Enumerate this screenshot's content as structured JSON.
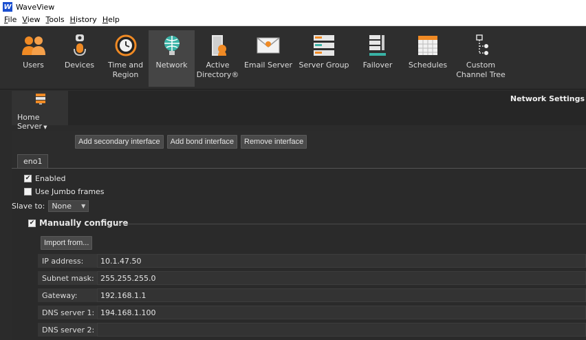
{
  "app": {
    "title": "WaveView",
    "logo_letter": "W"
  },
  "menu": [
    {
      "label": "File",
      "u": "F",
      "rest": "ile"
    },
    {
      "label": "View",
      "u": "V",
      "rest": "iew"
    },
    {
      "label": "Tools",
      "u": "T",
      "rest": "ools"
    },
    {
      "label": "History",
      "u": "H",
      "rest": "istory"
    },
    {
      "label": "Help",
      "u": "H",
      "rest": "elp"
    }
  ],
  "toolbar": {
    "users": "Users",
    "devices": "Devices",
    "time_region_1": "Time and",
    "time_region_2": "Region",
    "network": "Network",
    "ad_1": "Active",
    "ad_2": "Directory®",
    "email": "Email Server",
    "server_group": "Server Group",
    "failover": "Failover",
    "schedules": "Schedules",
    "custom_1": "Custom",
    "custom_2": "Channel Tree",
    "active_item": "Network"
  },
  "server": {
    "label": "Home Server",
    "section_title": "Network Settings"
  },
  "actions": {
    "add_secondary": "Add secondary interface",
    "add_bond": "Add bond interface",
    "remove": "Remove interface"
  },
  "tab": {
    "label": "eno1"
  },
  "options": {
    "enabled_label": "Enabled",
    "enabled_checked": true,
    "jumbo_label": "Use Jumbo frames",
    "jumbo_checked": false,
    "slave_label": "Slave to:",
    "slave_value": "None"
  },
  "manual": {
    "title": "Manually configure",
    "checked": true,
    "import_label": "Import from...",
    "fields": {
      "ip_label": "IP address:",
      "ip_value": "10.1.47.50",
      "subnet_label": "Subnet mask:",
      "subnet_value": "255.255.255.0",
      "gateway_label": "Gateway:",
      "gateway_value": "192.168.1.1",
      "dns1_label": "DNS server 1:",
      "dns1_value": "194.168.1.100",
      "dns2_label": "DNS server 2:",
      "dns2_value": ""
    }
  },
  "colors": {
    "background": "#2b2b2b",
    "toolbar": "#2e2e2e",
    "active_tool": "#454545",
    "users_orange": "#f08a24",
    "network_teal": "#39b3a6"
  }
}
